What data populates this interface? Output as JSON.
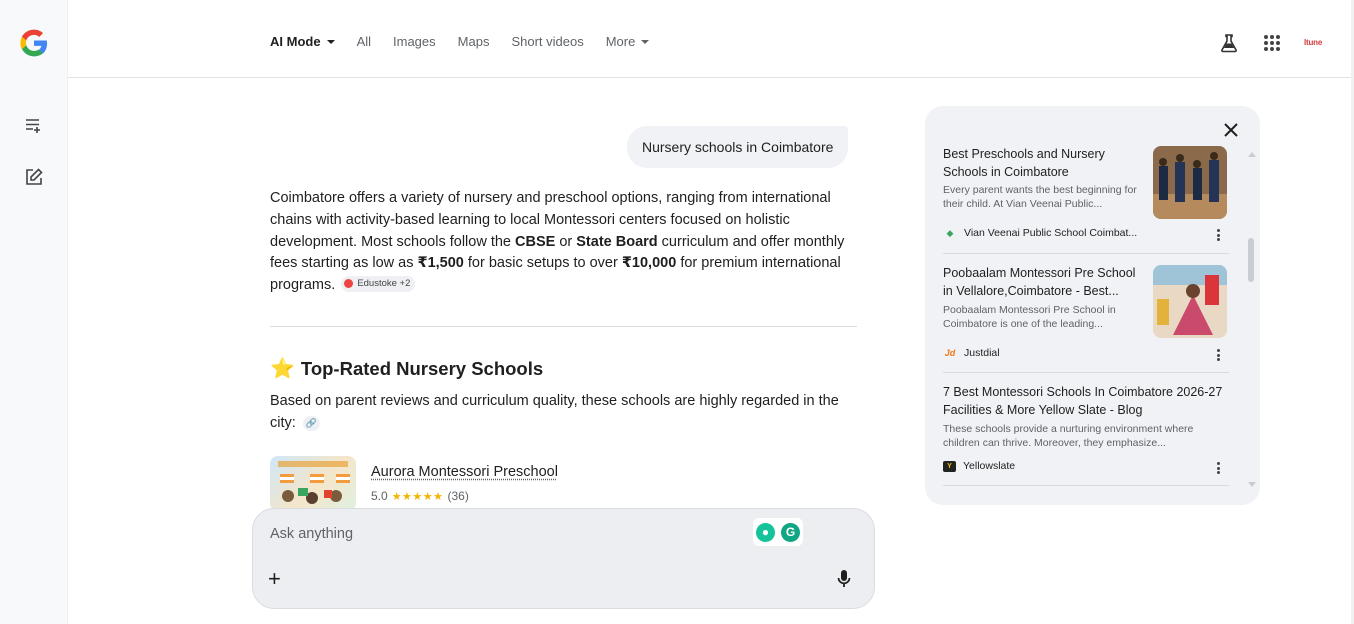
{
  "nav": {
    "tabs": [
      {
        "label": "AI Mode"
      },
      {
        "label": "All"
      },
      {
        "label": "Images"
      },
      {
        "label": "Maps"
      },
      {
        "label": "Short videos"
      },
      {
        "label": "More"
      }
    ],
    "profile_text": "ltune"
  },
  "conversation": {
    "query": "Nursery schools in Coimbatore",
    "answer": {
      "t1": "Coimbatore offers a variety of nursery and preschool options, ranging from international chains with activity-based learning to local Montessori centers focused on holistic development. Most schools follow the ",
      "b1": "CBSE",
      "t2": " or ",
      "b2": "State Board",
      "t3": " curriculum and offer monthly fees starting as low as ",
      "b3": "₹1,500",
      "t4": " for basic setups to over ",
      "b4": "₹10,000",
      "t5": " for premium international programs.",
      "citation": "Edustoke +2"
    },
    "section_title": "Top-Rated Nursery Schools",
    "section_intro": "Based on parent reviews and curriculum quality, these schools are highly regarded in the city:",
    "school": {
      "name": "Aurora Montessori Preschool",
      "rating": "5.0",
      "stars": "★★★★★",
      "reviews": "(36)"
    }
  },
  "ask": {
    "placeholder": "Ask anything"
  },
  "sources": [
    {
      "title": "Best Preschools and Nursery Schools in Coimbatore",
      "snippet": "Every parent wants the best beginning for their child. At Vian Veenai Public...",
      "source": "Vian Veenai Public School Coimbat..."
    },
    {
      "title": "Poobaalam Montessori Pre School in Vellalore,Coimbatore - Best...",
      "snippet": "Poobaalam Montessori Pre School in Coimbatore is one of the leading...",
      "source": "Justdial"
    },
    {
      "title": "7 Best Montessori Schools In Coimbatore 2026-27 Facilities & More Yellow Slate - Blog",
      "snippet": "These schools provide a nurturing environment where children can thrive. Moreover, they emphasize...",
      "source": "Yellowslate"
    }
  ],
  "colors": {
    "accent_star": "#f5b400",
    "panel_bg": "#f0f2f5",
    "grammarly": "#15c39a"
  },
  "icons": [
    "google-logo",
    "new-thread-icon",
    "edit-icon",
    "labs-flask-icon",
    "apps-grid-icon",
    "close-icon",
    "mic-icon",
    "plus-icon",
    "link-icon",
    "kebab-icon"
  ]
}
